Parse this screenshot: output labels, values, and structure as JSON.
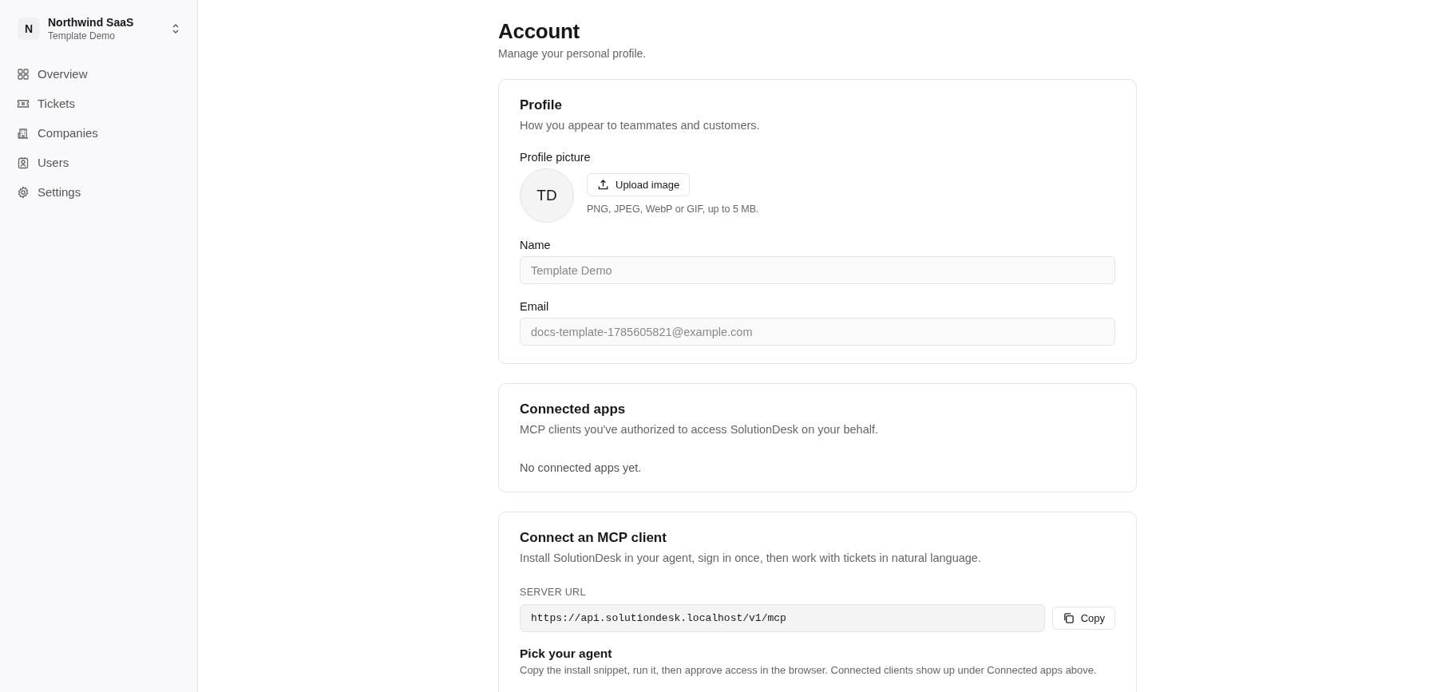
{
  "workspace": {
    "initial": "N",
    "name": "Northwind SaaS",
    "subtitle": "Template Demo"
  },
  "nav": [
    {
      "label": "Overview",
      "selected": false
    },
    {
      "label": "Tickets",
      "selected": false
    },
    {
      "label": "Companies",
      "selected": false
    },
    {
      "label": "Users",
      "selected": false
    },
    {
      "label": "Settings",
      "selected": false
    }
  ],
  "page": {
    "title": "Account",
    "subtitle": "Manage your personal profile."
  },
  "profile": {
    "title": "Profile",
    "description": "How you appear to teammates and customers.",
    "picture_label": "Profile picture",
    "avatar": "TD",
    "upload_button": "Upload image",
    "upload_hint": "PNG, JPEG, WebP or GIF, up to 5 MB.",
    "fields": [
      {
        "label": "Name",
        "value": "Template Demo",
        "disabled": true
      },
      {
        "label": "Email",
        "value": "docs-template-1785605821@example.com",
        "disabled": true
      }
    ]
  },
  "connected_apps": {
    "title": "Connected apps",
    "description": "MCP clients you've authorized to access SolutionDesk on your behalf.",
    "empty": "No connected apps yet."
  },
  "mcp": {
    "title": "Connect an MCP client",
    "description": "Install SolutionDesk in your agent, sign in once, then work with tickets in natural language.",
    "url_label": "SERVER URL",
    "url": "https://api.solutiondesk.localhost/v1/mcp",
    "copy_button": "Copy",
    "agent_title": "Pick your agent",
    "agent_description": "Copy the install snippet, run it, then approve access in the browser. Connected clients show up under Connected apps above."
  }
}
